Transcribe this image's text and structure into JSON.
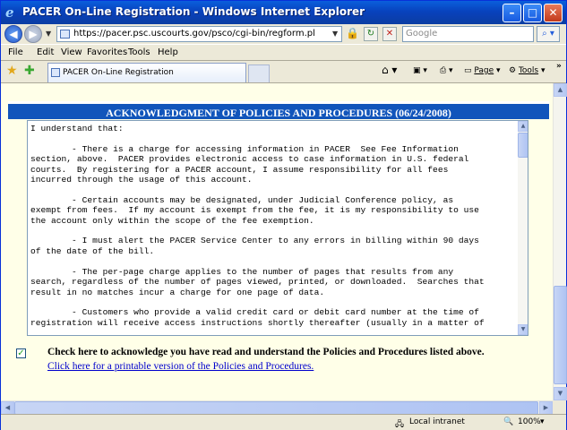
{
  "window": {
    "title": "PACER On-Line Registration - Windows Internet Explorer",
    "minimize": "–",
    "maximize": "□",
    "close": "✕"
  },
  "address_bar": {
    "url": "https://pacer.psc.uscourts.gov/psco/cgi-bin/regform.pl",
    "search_placeholder": "Google"
  },
  "menu": [
    "File",
    "Edit",
    "View",
    "Favorites",
    "Tools",
    "Help"
  ],
  "tab": {
    "label": "PACER On-Line Registration"
  },
  "toolbar": {
    "page_label": "Page",
    "tools_label": "Tools"
  },
  "page": {
    "heading": "ACKNOWLEDGMENT OF POLICIES AND PROCEDURES (06/24/2008)",
    "policy_text": "I understand that:\n\n        - There is a charge for accessing information in PACER  See Fee Information\nsection, above.  PACER provides electronic access to case information in U.S. federal\ncourts.  By registering for a PACER account, I assume responsibility for all fees\nincurred through the usage of this account.\n\n        - Certain accounts may be designated, under Judicial Conference policy, as\nexempt from fees.  If my account is exempt from the fee, it is my responsibility to use\nthe account only within the scope of the fee exemption.\n\n        - I must alert the PACER Service Center to any errors in billing within 90 days\nof the date of the bill.\n\n        - The per-page charge applies to the number of pages that results from any\nsearch, regardless of the number of pages viewed, printed, or downloaded.  Searches that\nresult in no matches incur a charge for one page of data.\n\n        - Customers who provide a valid credit card or debit card number at the time of\nregistration will receive access instructions shortly thereafter (usually in a matter of",
    "acknowledge_checked": true,
    "acknowledge_label": "Check here to acknowledge you have read and understand the Policies and Procedures listed above.",
    "printable_link": "Click here for a printable version of the Policies and Procedures."
  },
  "status_bar": {
    "zone": "Local intranet",
    "zoom": "100%"
  }
}
